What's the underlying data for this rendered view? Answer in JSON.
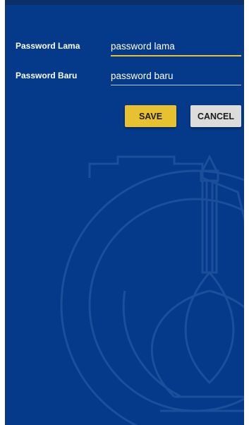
{
  "form": {
    "old_password_label": "Password Lama",
    "old_password_value": "password lama",
    "new_password_label": "Password Baru",
    "new_password_value": "password baru"
  },
  "buttons": {
    "save_label": "SAVE",
    "cancel_label": "CANCEL"
  },
  "colors": {
    "background": "#043a89",
    "accent": "#e8c130",
    "cancel_button": "#dcdcdc"
  },
  "icons": {
    "watermark": "its-emblem-watermark-icon"
  }
}
